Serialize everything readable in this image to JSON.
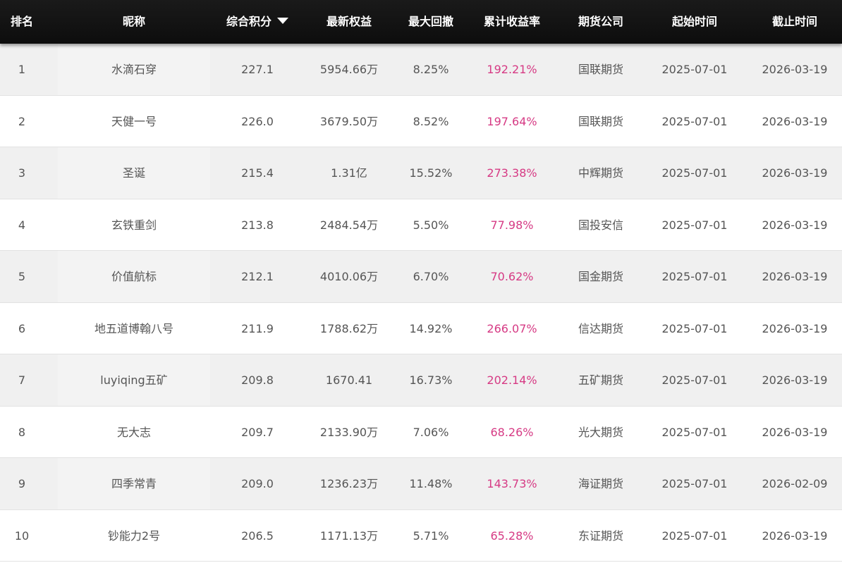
{
  "header": {
    "rank": "排名",
    "nickname": "昵称",
    "score": "综合积分",
    "equity": "最新权益",
    "drawdown": "最大回撤",
    "return": "累计收益率",
    "broker": "期货公司",
    "start": "起始时间",
    "end": "截止时间",
    "sort_icon": "sort-down-icon"
  },
  "colors": {
    "header_bg": "#111111",
    "return_text": "#d63a84",
    "row_alt": "#f0f0f0"
  },
  "rows": [
    {
      "rank": "1",
      "nickname": "水滴石穿",
      "score": "227.1",
      "equity": "5954.66万",
      "drawdown": "8.25%",
      "return": "192.21%",
      "broker": "国联期货",
      "start": "2025-07-01",
      "end": "2026-03-19"
    },
    {
      "rank": "2",
      "nickname": "天健一号",
      "score": "226.0",
      "equity": "3679.50万",
      "drawdown": "8.52%",
      "return": "197.64%",
      "broker": "国联期货",
      "start": "2025-07-01",
      "end": "2026-03-19"
    },
    {
      "rank": "3",
      "nickname": "圣诞",
      "score": "215.4",
      "equity": "1.31亿",
      "drawdown": "15.52%",
      "return": "273.38%",
      "broker": "中辉期货",
      "start": "2025-07-01",
      "end": "2026-03-19"
    },
    {
      "rank": "4",
      "nickname": "玄铁重剑",
      "score": "213.8",
      "equity": "2484.54万",
      "drawdown": "5.50%",
      "return": "77.98%",
      "broker": "国投安信",
      "start": "2025-07-01",
      "end": "2026-03-19"
    },
    {
      "rank": "5",
      "nickname": "价值航标",
      "score": "212.1",
      "equity": "4010.06万",
      "drawdown": "6.70%",
      "return": "70.62%",
      "broker": "国金期货",
      "start": "2025-07-01",
      "end": "2026-03-19"
    },
    {
      "rank": "6",
      "nickname": "地五道博翰八号",
      "score": "211.9",
      "equity": "1788.62万",
      "drawdown": "14.92%",
      "return": "266.07%",
      "broker": "信达期货",
      "start": "2025-07-01",
      "end": "2026-03-19"
    },
    {
      "rank": "7",
      "nickname": "luyiqing五矿",
      "score": "209.8",
      "equity": "1670.41",
      "drawdown": "16.73%",
      "return": "202.14%",
      "broker": "五矿期货",
      "start": "2025-07-01",
      "end": "2026-03-19"
    },
    {
      "rank": "8",
      "nickname": "无大志",
      "score": "209.7",
      "equity": "2133.90万",
      "drawdown": "7.06%",
      "return": "68.26%",
      "broker": "光大期货",
      "start": "2025-07-01",
      "end": "2026-03-19"
    },
    {
      "rank": "9",
      "nickname": "四季常青",
      "score": "209.0",
      "equity": "1236.23万",
      "drawdown": "11.48%",
      "return": "143.73%",
      "broker": "海证期货",
      "start": "2025-07-01",
      "end": "2026-02-09"
    },
    {
      "rank": "10",
      "nickname": "钞能力2号",
      "score": "206.5",
      "equity": "1171.13万",
      "drawdown": "5.71%",
      "return": "65.28%",
      "broker": "东证期货",
      "start": "2025-07-01",
      "end": "2026-03-19"
    }
  ]
}
